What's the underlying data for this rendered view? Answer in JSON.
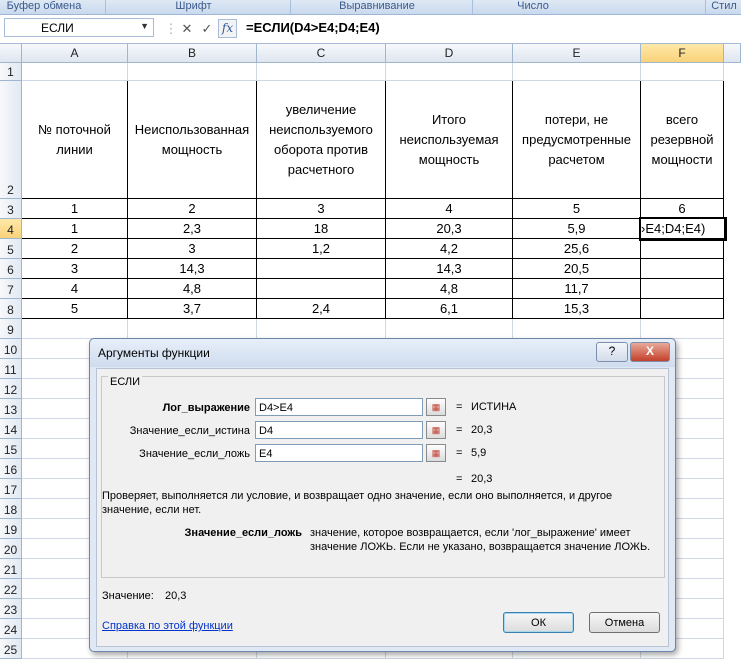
{
  "ribbon": {
    "groups": [
      "Буфер обмена",
      "Шрифт",
      "Выравнивание",
      "Число",
      "Стил"
    ]
  },
  "formula_bar": {
    "name_box": "ЕСЛИ",
    "cancel_icon": "✕",
    "enter_icon": "✓",
    "fx_label": "fx",
    "formula": "=ЕСЛИ(D4>E4;D4;E4)"
  },
  "sheet": {
    "columns": [
      "A",
      "B",
      "C",
      "D",
      "E",
      "F"
    ],
    "rows": [
      "1",
      "2",
      "3",
      "4",
      "5",
      "6",
      "7",
      "8",
      "9",
      "10",
      "11",
      "12",
      "13",
      "14",
      "15",
      "16",
      "17",
      "18",
      "19",
      "20",
      "21",
      "22",
      "23",
      "24",
      "25"
    ],
    "selected_column": "F",
    "selected_row": "4",
    "headers": [
      "№ поточной линии",
      "Неиспользованная мощность",
      "увеличение неиспользуемого оборота против расчетного",
      "Итого неиспользуемая мощность",
      "потери, не предусмотренные расчетом",
      "всего резервной мощности"
    ],
    "data_rows": [
      [
        "1",
        "2",
        "3",
        "4",
        "5",
        "6"
      ],
      [
        "1",
        "2,3",
        "18",
        "20,3",
        "5,9",
        "›E4;D4;E4)"
      ],
      [
        "2",
        "3",
        "1,2",
        "4,2",
        "25,6",
        ""
      ],
      [
        "3",
        "14,3",
        "",
        "14,3",
        "20,5",
        ""
      ],
      [
        "4",
        "4,8",
        "",
        "4,8",
        "11,7",
        ""
      ],
      [
        "5",
        "3,7",
        "2,4",
        "6,1",
        "15,3",
        ""
      ]
    ]
  },
  "dialog": {
    "title": "Аргументы функции",
    "help_button": "?",
    "close_button": "X",
    "function_name": "ЕСЛИ",
    "args": [
      {
        "label": "Лог_выражение",
        "value": "D4>E4",
        "result": "ИСТИНА"
      },
      {
        "label": "Значение_если_истина",
        "value": "D4",
        "result": "20,3"
      },
      {
        "label": "Значение_если_ложь",
        "value": "E4",
        "result": "5,9"
      }
    ],
    "eq_sign": "=",
    "formula_result": "20,3",
    "description": "Проверяет, выполняется ли условие, и возвращает одно значение, если оно выполняется, и другое значение, если нет.",
    "arg_name": "Значение_если_ложь",
    "arg_desc": "значение, которое возвращается, если 'лог_выражение' имеет значение ЛОЖЬ. Если не указано, возвращается значение ЛОЖЬ.",
    "value_label": "Значение:",
    "value": "20,3",
    "help_link": "Справка по этой функции",
    "ok": "ОК",
    "cancel": "Отмена"
  }
}
